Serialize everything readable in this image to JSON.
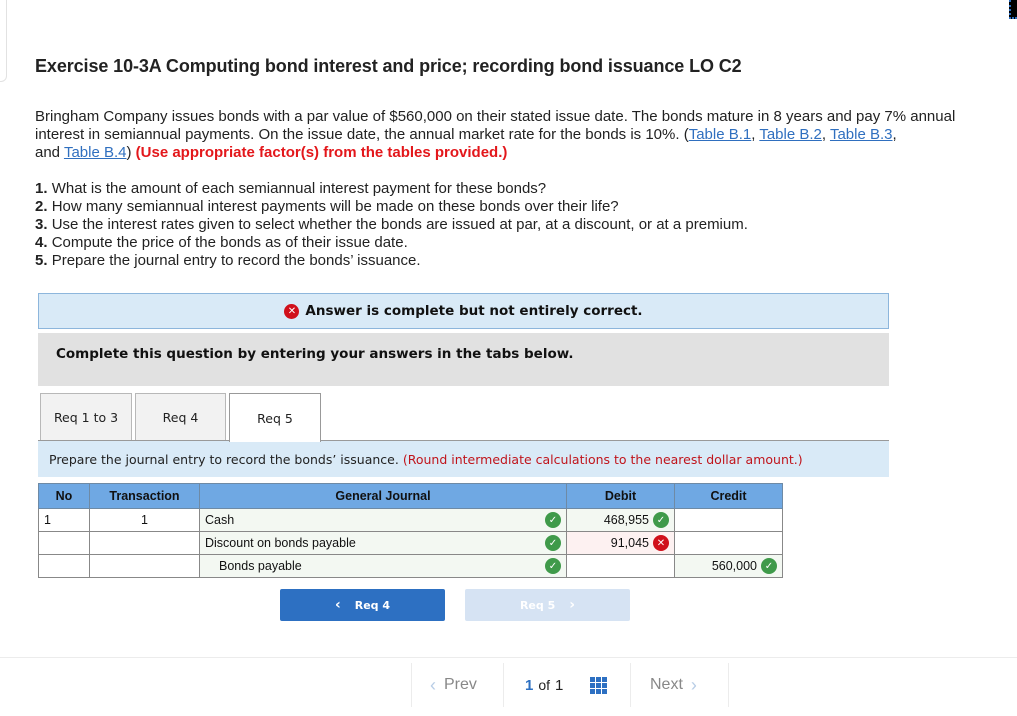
{
  "exercise": {
    "title": "Exercise 10-3A Computing bond interest and price; recording bond issuance LO C2",
    "intro_text": "Bringham Company issues bonds with a par value of $560,000 on their stated issue date. The bonds mature in 8 years and pay 7% annual interest in semiannual payments. On the issue date, the annual market rate for the bonds is 10%. (",
    "table_links": [
      "Table B.1",
      "Table B.2",
      "Table B.3",
      "Table B.4"
    ],
    "link_separator": ", ",
    "link_and": "and ",
    "intro_close": ")",
    "instruction_note": "(Use appropriate factor(s) from the tables provided.)",
    "requirements": [
      {
        "num": "1.",
        "text": "What is the amount of each semiannual interest payment for these bonds?"
      },
      {
        "num": "2.",
        "text": "How many semiannual interest payments will be made on these bonds over their life?"
      },
      {
        "num": "3.",
        "text": "Use the interest rates given to select whether the bonds are issued at par, at a discount, or at a premium."
      },
      {
        "num": "4.",
        "text": "Compute the price of the bonds as of their issue date."
      },
      {
        "num": "5.",
        "text": "Prepare the journal entry to record the bonds’ issuance."
      }
    ]
  },
  "status": {
    "message": "Answer is complete but not entirely correct.",
    "icon": "x-circle-icon"
  },
  "instruction_box": "Complete this question by entering your answers in the tabs below.",
  "tabs": [
    {
      "label": "Req 1 to 3",
      "active": false
    },
    {
      "label": "Req 4",
      "active": false
    },
    {
      "label": "Req 5",
      "active": true
    }
  ],
  "prompt": {
    "text": "Prepare the journal entry to record the bonds’ issuance.",
    "note": "(Round intermediate calculations to the nearest dollar amount.)"
  },
  "journal": {
    "headers": [
      "No",
      "Transaction",
      "General Journal",
      "Debit",
      "Credit"
    ],
    "rows": [
      {
        "no": "1",
        "transaction": "1",
        "account": "Cash",
        "account_status": "correct",
        "debit": "468,955",
        "debit_status": "correct",
        "credit": "",
        "credit_status": ""
      },
      {
        "no": "",
        "transaction": "",
        "account": "Discount on bonds payable",
        "account_status": "correct",
        "debit": "91,045",
        "debit_status": "incorrect",
        "credit": "",
        "credit_status": ""
      },
      {
        "no": "",
        "transaction": "",
        "account": "Bonds payable",
        "account_status": "correct",
        "debit": "",
        "debit_status": "",
        "credit": "560,000",
        "credit_status": "correct"
      }
    ]
  },
  "nav_buttons": {
    "prev_label": "Req 4",
    "next_label": "Req 5",
    "prev_icon": "‹",
    "next_icon": "›"
  },
  "pager": {
    "prev_label": "Prev",
    "next_label": "Next",
    "current": "1",
    "of_label": "of",
    "total": "1",
    "prev_icon": "‹",
    "next_icon": "›"
  },
  "colors": {
    "accent": "#2d70c2",
    "error": "#d0101b",
    "success": "#3f9a4a",
    "banner_bg": "#d9eaf7",
    "table_header": "#6fa8e3"
  }
}
